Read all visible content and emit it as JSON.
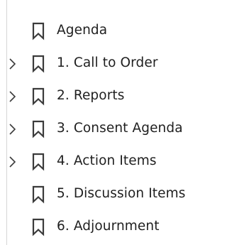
{
  "bookmarks_panel": {
    "items": [
      {
        "label": "Agenda",
        "has_children": false,
        "icon": "bookmark-icon"
      },
      {
        "label": "1. Call to Order",
        "has_children": true,
        "icon": "bookmark-icon"
      },
      {
        "label": "2. Reports",
        "has_children": true,
        "icon": "bookmark-icon"
      },
      {
        "label": "3. Consent Agenda",
        "has_children": true,
        "icon": "bookmark-icon"
      },
      {
        "label": "4. Action Items",
        "has_children": true,
        "icon": "bookmark-icon"
      },
      {
        "label": "5. Discussion Items",
        "has_children": false,
        "icon": "bookmark-icon"
      },
      {
        "label": "6. Adjournment",
        "has_children": false,
        "icon": "bookmark-icon"
      }
    ],
    "colors": {
      "text": "#1f1f1f",
      "icon": "#3b3b3b",
      "chevron": "#3b3b3b",
      "border": "#d6d6d6",
      "background": "#ffffff"
    }
  }
}
